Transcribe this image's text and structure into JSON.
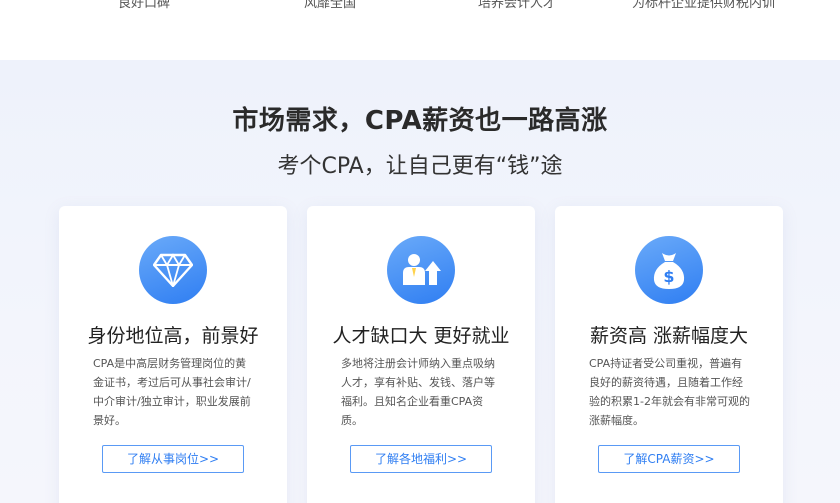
{
  "top_strip": {
    "items": [
      "良好口碑",
      "风靡全国",
      "培养会计人才",
      "为标杆企业提供财税内训"
    ]
  },
  "section": {
    "title": "市场需求，CPA薪资也一路高涨",
    "subtitle": "考个CPA，让自己更有“钱”途"
  },
  "cards": [
    {
      "icon": "diamond-icon",
      "title": "身份地位高，前景好",
      "desc": "CPA是中高层财务管理岗位的黄金证书，考过后可从事社会审计/中介审计/独立审计，职业发展前景好。",
      "link": "了解从事岗位>>"
    },
    {
      "icon": "person-growth-icon",
      "title": "人才缺口大 更好就业",
      "desc": "多地将注册会计师纳入重点吸纳人才，享有补贴、发钱、落户等福利。且知名企业看重CPA资质。",
      "link": "了解各地福利>>"
    },
    {
      "icon": "money-bag-icon",
      "title": "薪资高 涨薪幅度大",
      "desc": "CPA持证者受公司重视，普遍有良好的薪资待遇，且随着工作经验的积累1-2年就会有非常可观的涨薪幅度。",
      "link": "了解CPA薪资>>"
    }
  ],
  "colors": {
    "accent": "#2f7ef2",
    "section_bg": "#eef2fb"
  }
}
